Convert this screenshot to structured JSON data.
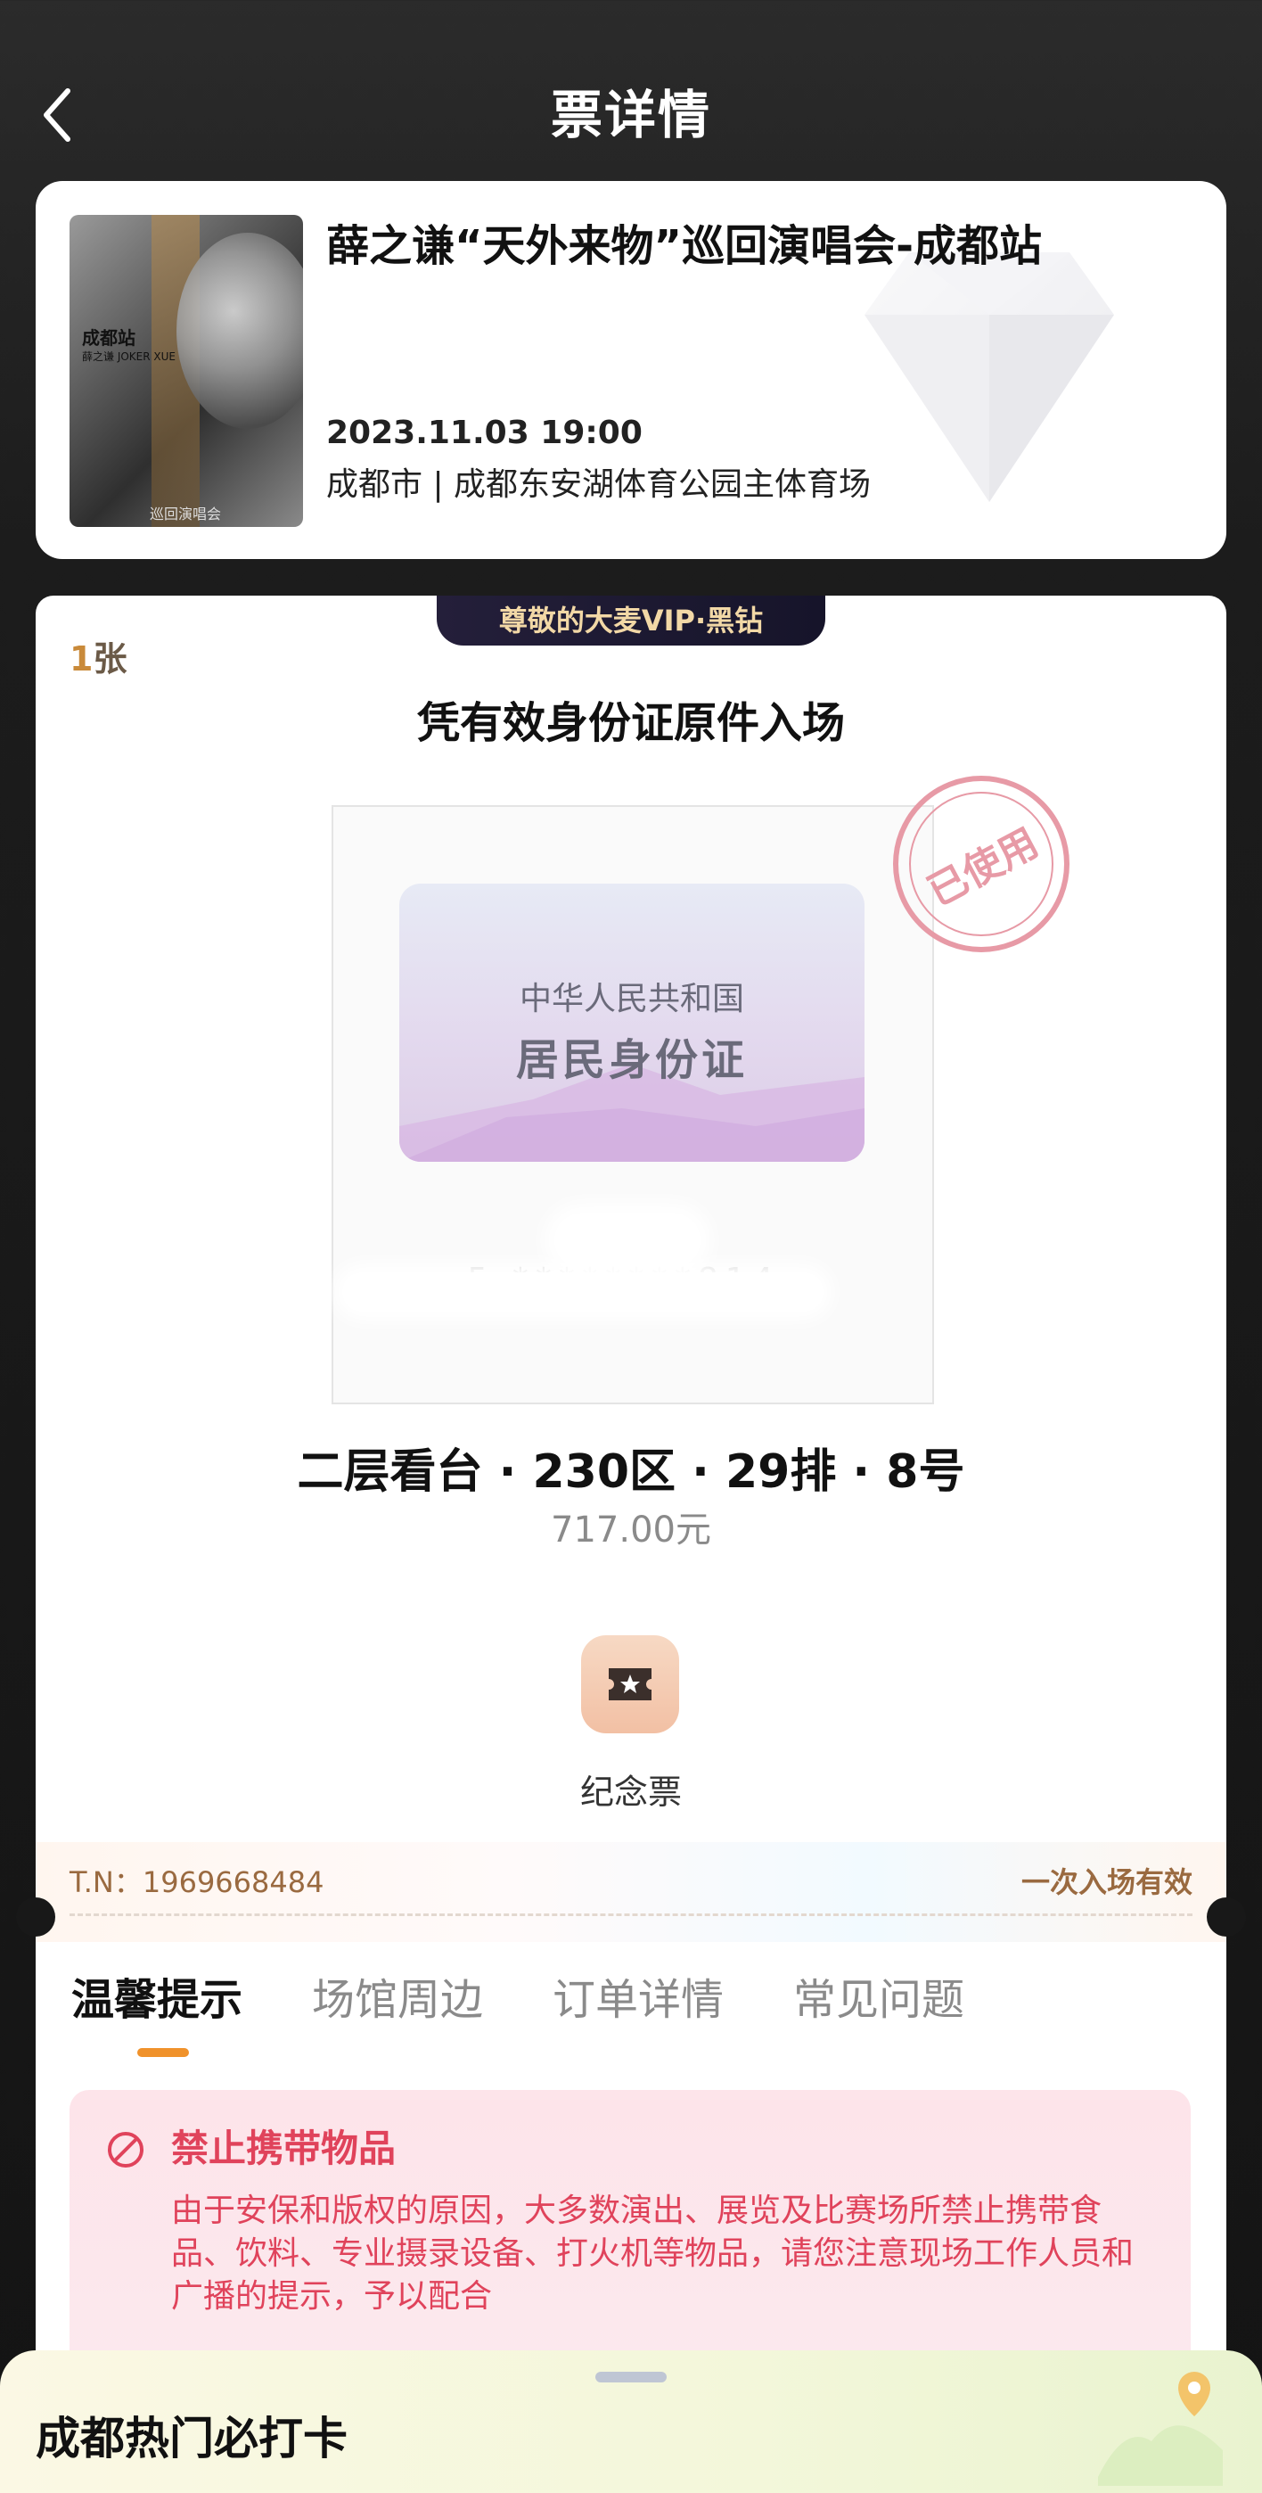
{
  "header": {
    "title": "票详情",
    "back_icon": "chevron-left-icon"
  },
  "event": {
    "title": "薛之谦“天外来物”巡回演唱会-成都站",
    "datetime": "2023.11.03 19:00",
    "venue": "成都市 | 成都东安湖体育公园主体育场",
    "poster": {
      "city_label": "成都站",
      "artist_label": "薛之谦 JOKER XUE",
      "tour_label": "巡回演唱会"
    }
  },
  "ticket": {
    "vip_badge": "尊敬的大麦VIP·黑钻",
    "count_number": "1",
    "count_unit": "张",
    "entry_rule": "凭有效身份证原件入场",
    "id_card": {
      "country": "中华人民共和国",
      "type": "居民身份证",
      "masked_number": "5  ********814"
    },
    "stamp": "已使用",
    "seat": "二层看台 · 230区 · 29排 · 8号",
    "price": "717.00元",
    "souvenir_label": "纪念票",
    "tn": "T.N：1969668484",
    "validity": "一次入场有效"
  },
  "tabs": [
    {
      "label": "温馨提示",
      "active": true
    },
    {
      "label": "场馆周边",
      "active": false
    },
    {
      "label": "订单详情",
      "active": false
    },
    {
      "label": "常见问题",
      "active": false
    }
  ],
  "notice": {
    "icon": "prohibited-icon",
    "title": "禁止携带物品",
    "body": "由于安保和版权的原因，大多数演出、展览及比赛场所禁止携带食品、饮料、专业摄录设备、打火机等物品，请您注意现场工作人员和广播的提示，予以配合"
  },
  "bottom_sheet": {
    "title": "成都热门必打卡"
  },
  "colors": {
    "accent_orange": "#f0922b",
    "notice_red": "#e0435b",
    "stamp_pink": "#e79aa6",
    "vip_gold": "#f2d8a6"
  }
}
